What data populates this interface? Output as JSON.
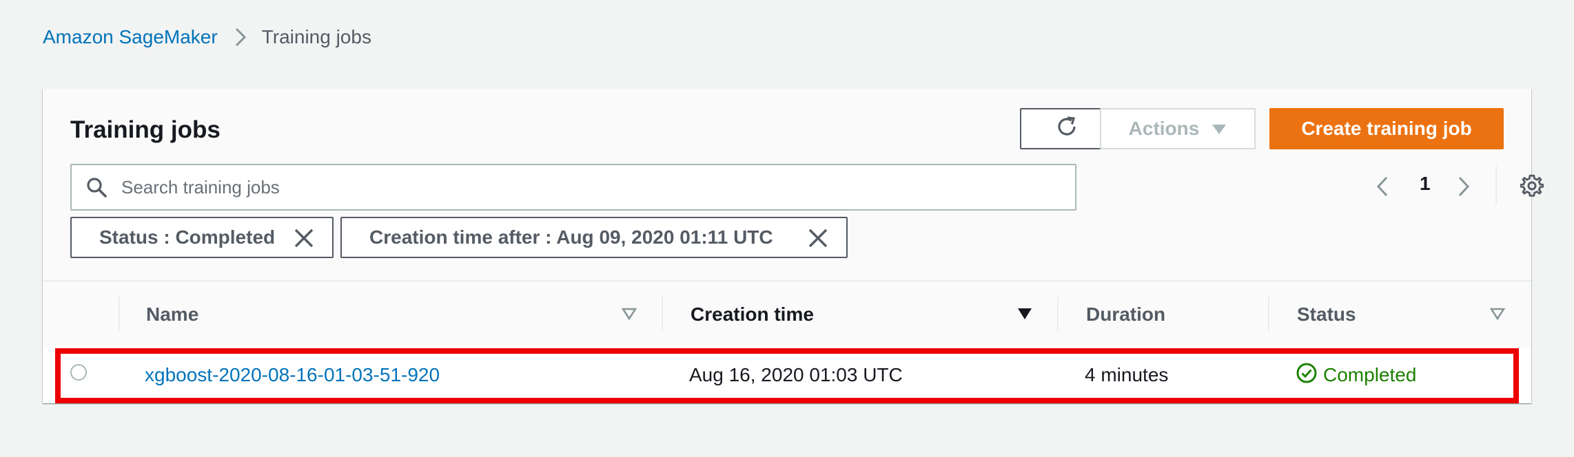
{
  "breadcrumb": {
    "root": "Amazon SageMaker",
    "current": "Training jobs"
  },
  "panel": {
    "title": "Training jobs",
    "actions_label": "Actions",
    "create_label": "Create training job"
  },
  "search": {
    "placeholder": "Search training jobs"
  },
  "pagination": {
    "page": "1"
  },
  "filters": [
    {
      "label": "Status : Completed"
    },
    {
      "label": "Creation time after : Aug 09, 2020 01:11 UTC"
    }
  ],
  "table": {
    "columns": {
      "name": "Name",
      "creation_time": "Creation time",
      "duration": "Duration",
      "status": "Status"
    },
    "rows": [
      {
        "name": "xgboost-2020-08-16-01-03-51-920",
        "creation_time": "Aug 16, 2020 01:03 UTC",
        "duration": "4 minutes",
        "status": "Completed"
      }
    ]
  },
  "colors": {
    "link": "#0073bb",
    "primary": "#ec7211",
    "success": "#1d8102",
    "highlight": "#ee0000"
  },
  "icons": [
    "chevron-right-icon",
    "refresh-icon",
    "caret-down-icon",
    "search-icon",
    "chevron-left-icon",
    "gear-icon",
    "close-icon",
    "sort-icon",
    "check-circle-icon"
  ]
}
